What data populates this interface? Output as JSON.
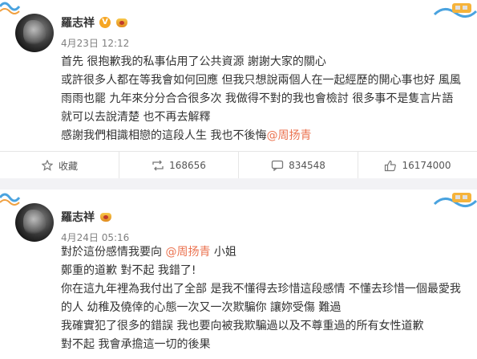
{
  "posts": [
    {
      "username": "羅志祥",
      "verified_badge": "V",
      "time": "4月23日 12:12",
      "lines": [
        "首先 很抱歉我的私事佔用了公共資源 謝謝大家的關心",
        "或許很多人都在等我會如何回應 但我只想說兩個人在一起經歷的開心事也好 風風",
        "雨雨也罷 九年來分分合合很多次 我做得不對的我也會檢討 很多事不是隻言片語",
        "就可以去說清楚 也不再去解釋"
      ],
      "last_line": {
        "text": "感謝我們相識相戀的這段人生 我也不後悔",
        "mention": "@周扬青"
      },
      "actions": {
        "favorite_label": "收藏",
        "repost_count": "168656",
        "comment_count": "834548",
        "like_count": "16174000"
      }
    },
    {
      "username": "羅志祥",
      "time": "4月24日 05:16",
      "first_line": {
        "pre": "對於這份感情我要向 ",
        "mention": "@周扬青",
        "post": " 小姐"
      },
      "lines": [
        "鄭重的道歉 對不起 我錯了!",
        "你在這九年裡為我付出了全部 是我不懂得去珍惜這段感情 不懂去珍惜一個最愛我",
        "的人 幼稚及僥倖的心態一次又一次欺騙你 讓妳受傷 難過",
        "我確實犯了很多的錯誤 我也要向被我欺騙過以及不尊重過的所有女性道歉",
        "對不起   我會承擔這一切的後果"
      ]
    }
  ],
  "colors": {
    "mention": "#eb7350",
    "verified_badge": "#f6a623",
    "gap": "#f2f2f5"
  },
  "icons": [
    "favorite-icon",
    "repost-icon",
    "comment-icon",
    "like-icon",
    "crown-icon"
  ]
}
